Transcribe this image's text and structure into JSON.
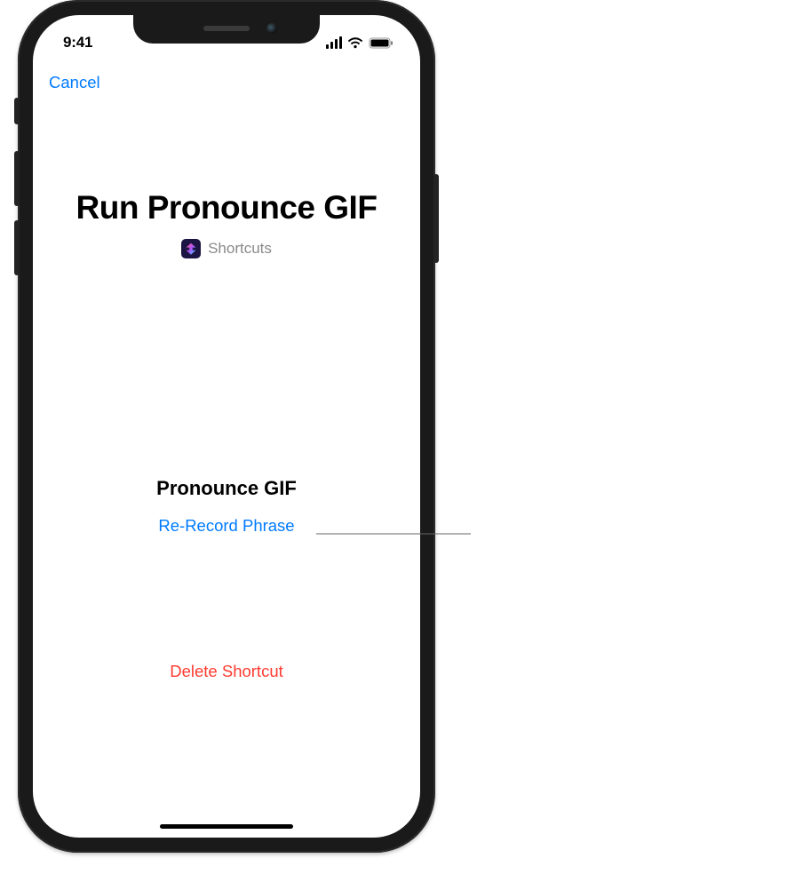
{
  "status": {
    "time": "9:41"
  },
  "nav": {
    "cancel": "Cancel"
  },
  "header": {
    "title": "Run Pronounce GIF",
    "app_name": "Shortcuts"
  },
  "phrase": {
    "title": "Pronounce GIF",
    "rerecord": "Re-Record Phrase"
  },
  "actions": {
    "delete": "Delete Shortcut"
  },
  "colors": {
    "link": "#007aff",
    "destructive": "#ff3b30"
  }
}
